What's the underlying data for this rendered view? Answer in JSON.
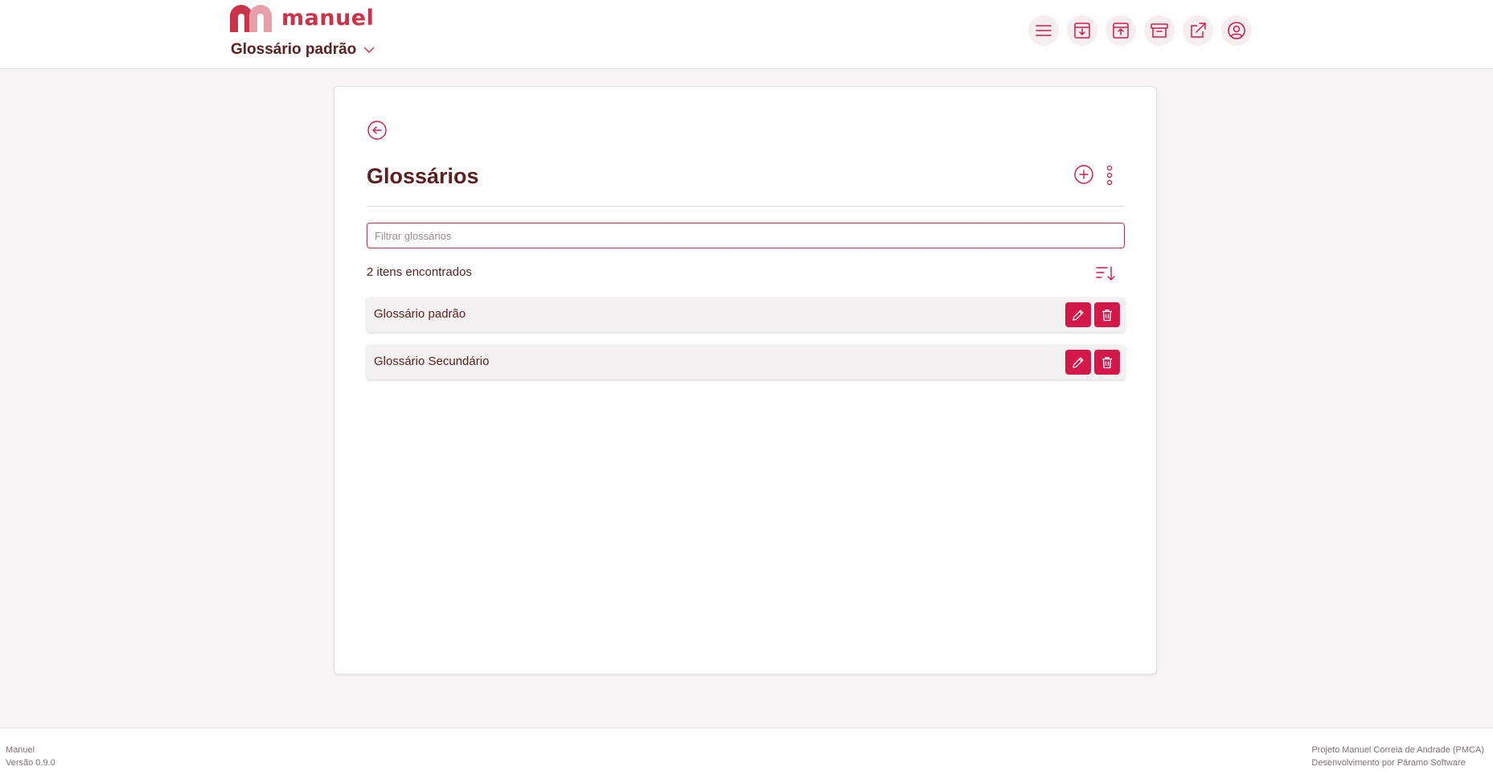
{
  "header": {
    "logo_text": "manuel",
    "selected_glossary": "Glossário padrão",
    "toolbar": [
      "menu-icon",
      "download-icon",
      "upload-icon",
      "archive-icon",
      "external-link-icon",
      "user-icon"
    ]
  },
  "main": {
    "title": "Glossários",
    "filter": {
      "placeholder": "Filtrar glossários",
      "value": ""
    },
    "count_text": "2 itens encontrados",
    "items": [
      {
        "name": "Glossário padrão"
      },
      {
        "name": "Glossário Secundário"
      }
    ]
  },
  "footer": {
    "app_name": "Manuel",
    "version": "Versão 0.9.0",
    "project": "Projeto Manuel Correia de Andrade (PMCA)",
    "developer": "Desenvolvimento por Páramo Software"
  },
  "colors": {
    "accent": "#d4184a",
    "brand": "#c9344a",
    "text": "#5a1f1f",
    "background": "#f7f6f4"
  }
}
